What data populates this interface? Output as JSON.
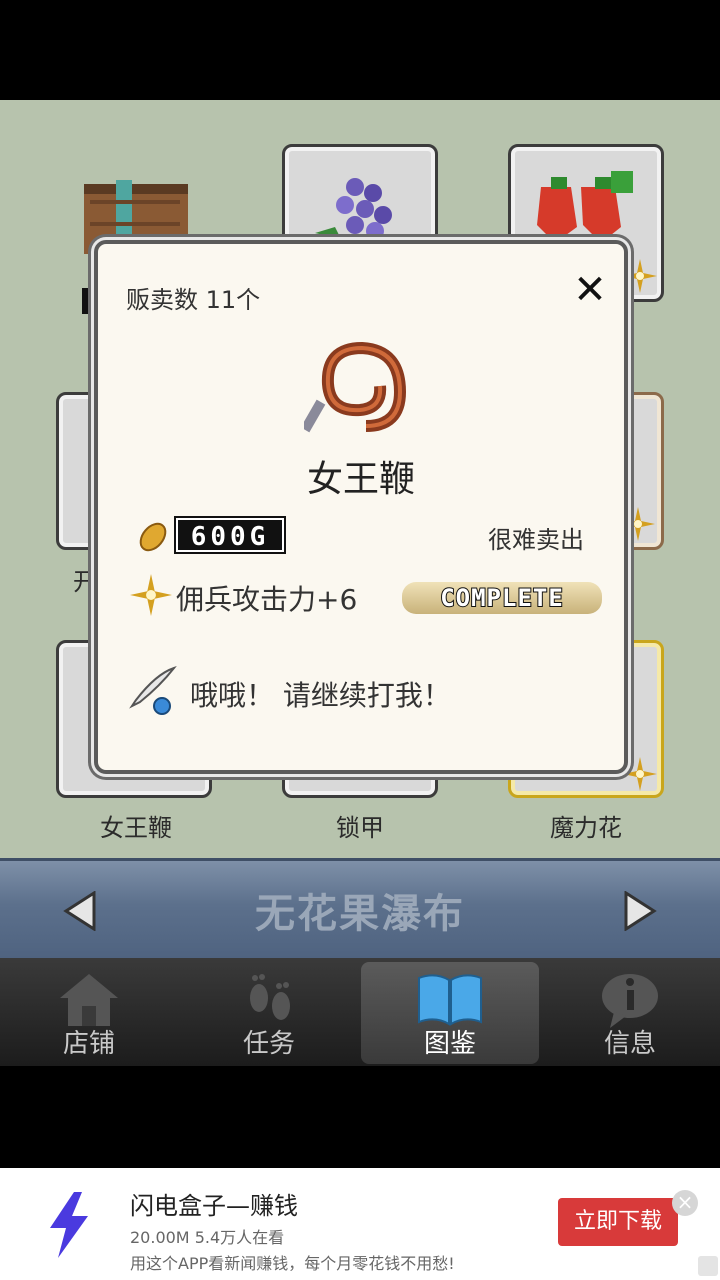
{
  "catalog": {
    "row1": [
      {
        "name": "item-crate"
      },
      {
        "name": "item-grapes"
      },
      {
        "name": "item-strawberries"
      }
    ],
    "row2_left_label_fragment": "开",
    "row3": [
      {
        "label": "女王鞭"
      },
      {
        "label": "锁甲"
      },
      {
        "label": "魔力花"
      }
    ]
  },
  "region": {
    "title": "无花果瀑布",
    "prev_icon": "left-arrow-icon",
    "next_icon": "right-arrow-icon"
  },
  "tabs": [
    {
      "label": "店铺",
      "icon": "house-icon",
      "active": false
    },
    {
      "label": "任务",
      "icon": "footprints-icon",
      "active": false
    },
    {
      "label": "图鉴",
      "icon": "book-icon",
      "active": true
    },
    {
      "label": "信息",
      "icon": "info-bubble-icon",
      "active": false
    }
  ],
  "modal": {
    "sold_label": "贩卖数 11个",
    "close_icon": "close-icon",
    "close_glyph": "✕",
    "item_name": "女王鞭",
    "price": "600G",
    "sell_note": "很难卖出",
    "effect": "佣兵攻击力+6",
    "status": "COMPLETE",
    "quote": "哦哦！ 请继续打我！"
  },
  "ad": {
    "title": "闪电盒子—赚钱",
    "sub": "20.00M 5.4万人在看",
    "desc": "用这个APP看新闻赚钱，每个月零花钱不用愁!",
    "button": "立即下载",
    "close_glyph": "×"
  },
  "colors": {
    "catalog_bg": "#b7c3ad",
    "region_bar": "#5c708c",
    "ad_button": "#d83a3a",
    "modal_bg": "#fbf8f0"
  }
}
